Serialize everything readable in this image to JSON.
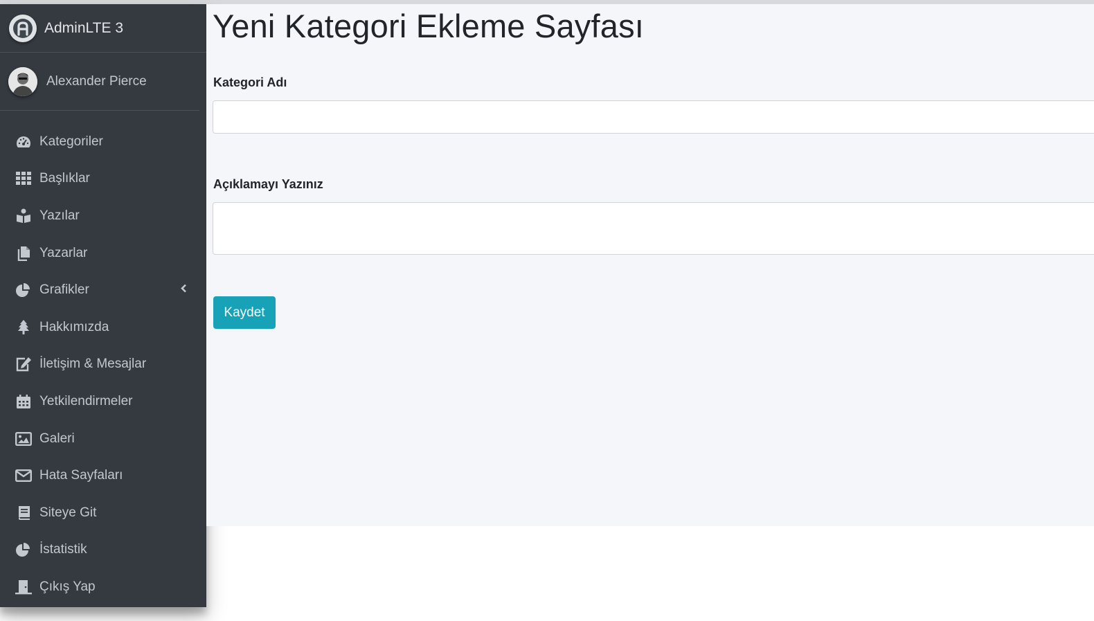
{
  "brand": {
    "name": "AdminLTE 3"
  },
  "user": {
    "name": "Alexander Pierce"
  },
  "sidebar": {
    "items": [
      {
        "label": "Kategoriler",
        "icon": "tachometer-icon"
      },
      {
        "label": "Başlıklar",
        "icon": "grid-icon"
      },
      {
        "label": "Yazılar",
        "icon": "book-reader-icon"
      },
      {
        "label": "Yazarlar",
        "icon": "copy-icon"
      },
      {
        "label": "Grafikler",
        "icon": "chart-pie-icon",
        "has_submenu": true
      },
      {
        "label": "Hakkımızda",
        "icon": "tree-icon"
      },
      {
        "label": "İletişim & Mesajlar",
        "icon": "edit-icon"
      },
      {
        "label": "Yetkilendirmeler",
        "icon": "calendar-icon"
      },
      {
        "label": "Galeri",
        "icon": "image-icon"
      },
      {
        "label": "Hata Sayfaları",
        "icon": "envelope-icon"
      },
      {
        "label": "Siteye Git",
        "icon": "book-icon"
      },
      {
        "label": "İstatistik",
        "icon": "chart-pie-icon"
      },
      {
        "label": "Çıkış Yap",
        "icon": "door-icon"
      }
    ]
  },
  "main": {
    "title": "Yeni Kategori Ekleme Sayfası",
    "category_name_label": "Kategori Adı",
    "category_name_value": "",
    "description_label": "Açıklamayı Yazınız",
    "description_value": "",
    "save_label": "Kaydet"
  },
  "colors": {
    "sidebar_bg": "#343a40",
    "content_bg": "#f4f6f9",
    "button": "#17a2b8"
  }
}
